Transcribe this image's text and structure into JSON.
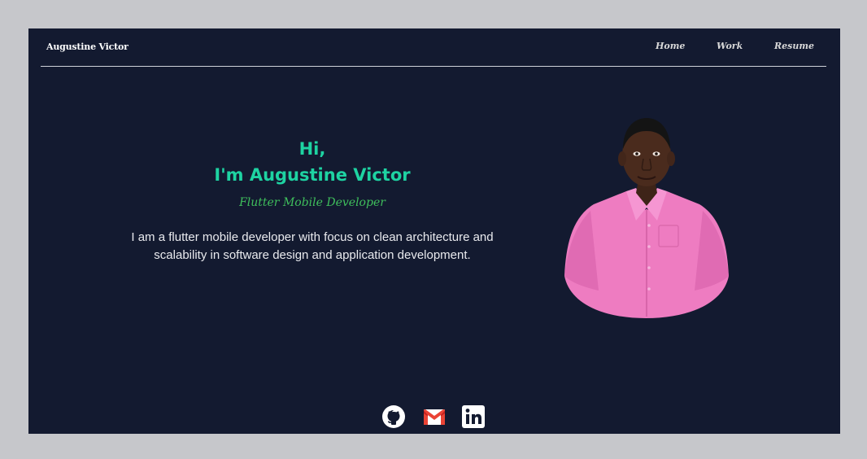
{
  "header": {
    "brand": "Augustine Victor",
    "nav": [
      "Home",
      "Work",
      "Resume"
    ]
  },
  "hero": {
    "greeting_line1": "Hi,",
    "greeting_line2": "I'm Augustine Victor",
    "role": "Flutter Mobile Developer",
    "description_line1": "I am a flutter mobile developer with focus on clean architecture and",
    "description_line2": "scalability in software design and application development."
  },
  "socials": [
    {
      "icon": "github-icon"
    },
    {
      "icon": "gmail-icon"
    },
    {
      "icon": "linkedin-icon"
    }
  ],
  "colors": {
    "background": "#131a30",
    "accent": "#1ed3a2",
    "role": "#3fbf5c",
    "shirt": "#f07fc4"
  }
}
